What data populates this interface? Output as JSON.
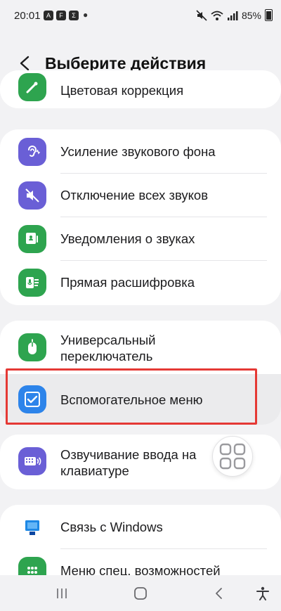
{
  "status_bar": {
    "time": "20:01",
    "notif_icons": [
      "A",
      "F",
      "Σ"
    ],
    "battery": "85%"
  },
  "header": {
    "title": "Выберите действия"
  },
  "items": {
    "color_correction": "Цветовая коррекция",
    "ambient_sound": "Усиление звукового фона",
    "mute_all": "Отключение всех звуков",
    "sound_notifications": "Уведомления о звуках",
    "live_transcribe": "Прямая расшифровка",
    "universal_switch_line1": "Универсальный",
    "universal_switch_line2": "переключатель",
    "assistant_menu": "Вспомогательное меню",
    "keyboard_speak_line1": "Озвучивание ввода на",
    "keyboard_speak_line2": "клавиатуре",
    "link_windows": "Связь с Windows",
    "accessibility_menu": "Меню спец. возможностей"
  },
  "colors": {
    "green": "#2ea44f",
    "purple": "#6a5fd6",
    "blue": "#2d84ea",
    "highlight_border": "#e53935"
  }
}
